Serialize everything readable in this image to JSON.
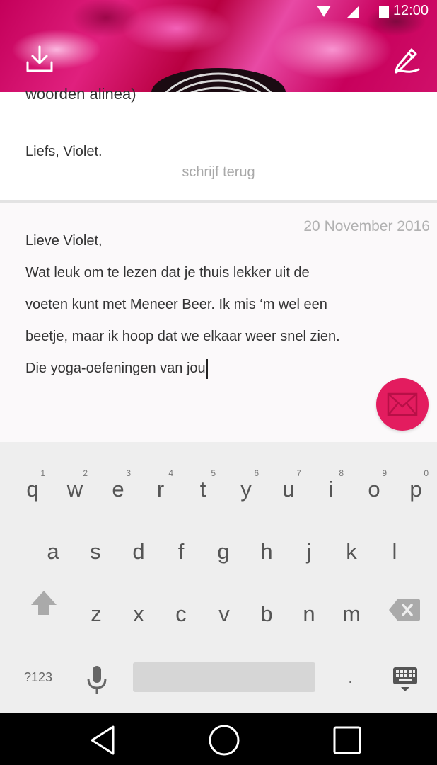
{
  "status": {
    "time": "12:00"
  },
  "icons": {
    "download": "download-icon",
    "edit": "pencil-icon",
    "send": "envelope-icon",
    "shift": "shift-arrow-icon",
    "backspace": "backspace-icon",
    "mic": "microphone-icon",
    "keyboard_switch": "keyboard-icon",
    "nav_back": "back-triangle-icon",
    "nav_home": "home-circle-icon",
    "nav_recents": "recents-square-icon"
  },
  "letter_prev": {
    "partial_line": "woorden alinea)",
    "signature": "Liefs, Violet.",
    "reply_link": "schrijf terug"
  },
  "compose": {
    "date": "20 November 2016",
    "lines": [
      "Lieve Violet,",
      "Wat leuk om te lezen dat je thuis lekker uit de",
      "voeten kunt met Meneer Beer. Ik mis ‘m wel een",
      "beetje, maar ik hoop dat we elkaar weer snel zien.",
      "Die yoga-oefeningen van jou"
    ]
  },
  "keyboard": {
    "row1": [
      "q",
      "w",
      "e",
      "r",
      "t",
      "y",
      "u",
      "i",
      "o",
      "p"
    ],
    "row1_hints": [
      "1",
      "2",
      "3",
      "4",
      "5",
      "6",
      "7",
      "8",
      "9",
      "0"
    ],
    "row2": [
      "a",
      "s",
      "d",
      "f",
      "g",
      "h",
      "j",
      "k",
      "l"
    ],
    "row3": [
      "z",
      "x",
      "c",
      "v",
      "b",
      "n",
      "m"
    ],
    "numsym_label": "?123",
    "period_label": "."
  },
  "colors": {
    "accent": "#e31c5f",
    "header": "#c4005a",
    "keyboard_bg": "#eeeeee"
  }
}
